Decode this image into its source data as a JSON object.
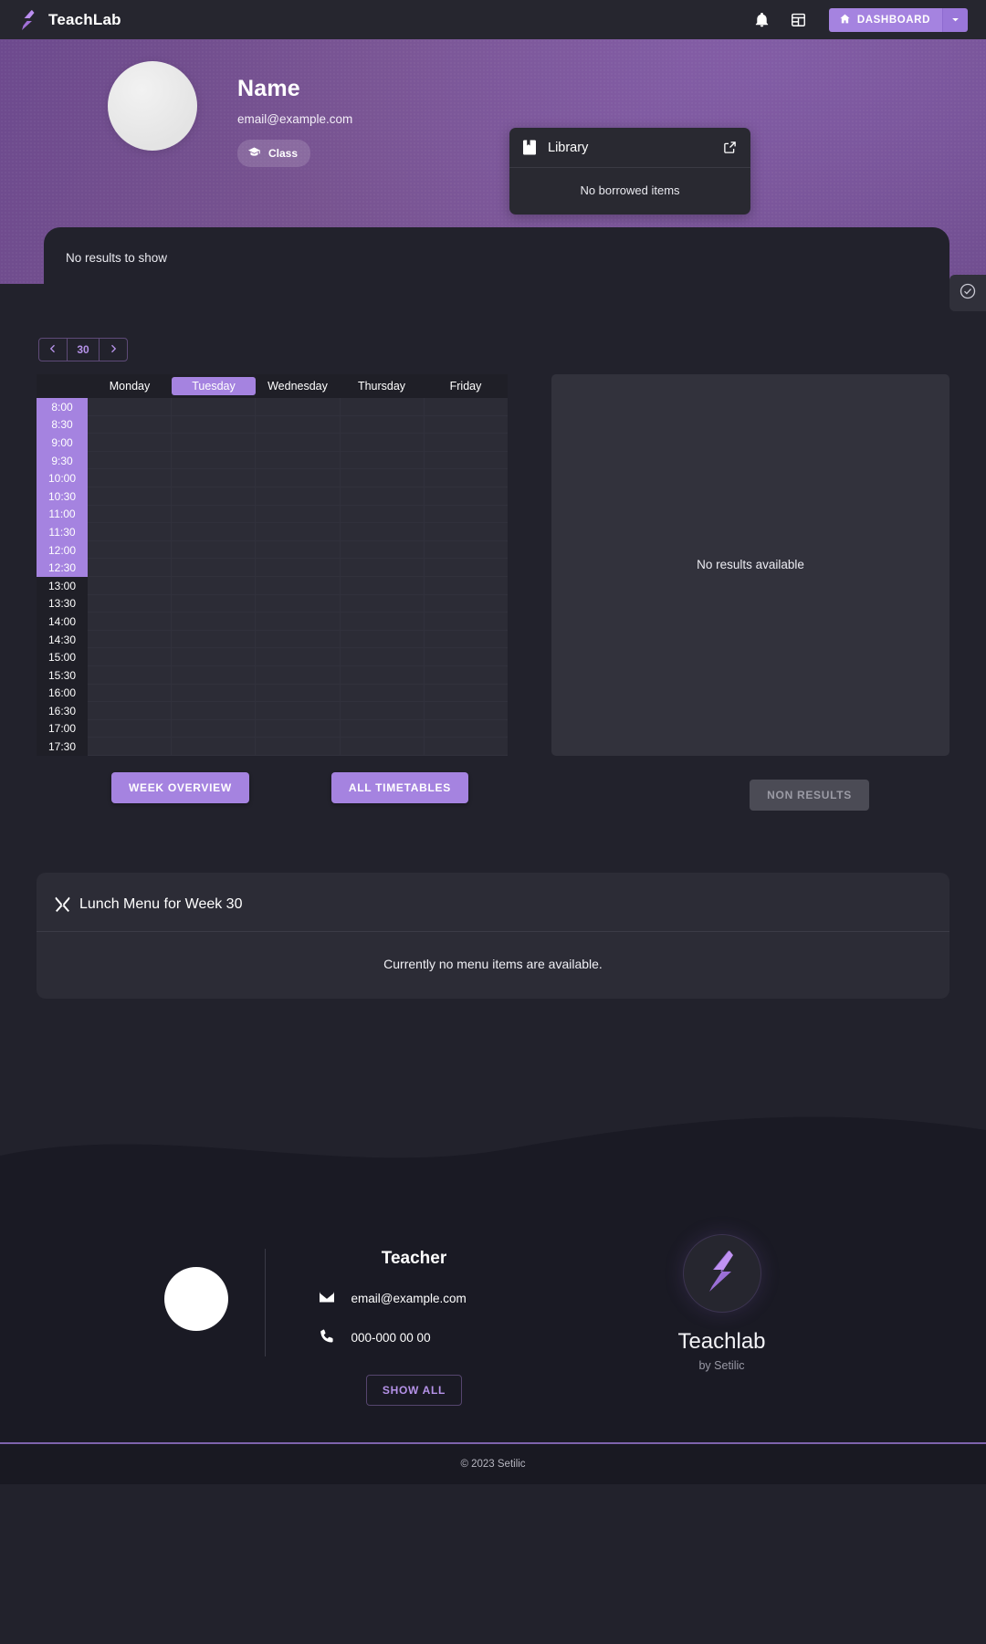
{
  "topnav": {
    "brand": "TeachLab",
    "logo_icon": "setilic-s-logo",
    "bell_icon": "bell-icon",
    "calendar_icon": "calendar-icon",
    "dashboard_label": "DASHBOARD",
    "dashboard_icon": "home-icon",
    "caret_icon": "chevron-down-icon",
    "accent": "#a583e0"
  },
  "hero": {
    "avatar": "profile-avatar",
    "name": "Name",
    "email": "email@example.com",
    "class_chip": "Class",
    "class_icon": "graduation-cap-icon",
    "bg_color": "#77538f"
  },
  "library": {
    "title": "Library",
    "icon": "book-icon",
    "external_icon": "external-link-icon",
    "empty_text": "No borrowed items"
  },
  "notice": {
    "text": "No results to show"
  },
  "check_tab": {
    "icon": "check-circle-icon"
  },
  "timetable": {
    "week_number": "30",
    "prev_icon": "chevron-left-icon",
    "next_icon": "chevron-right-icon",
    "days": [
      {
        "label": "Monday",
        "active": false
      },
      {
        "label": "Tuesday",
        "active": true
      },
      {
        "label": "Wednesday",
        "active": false
      },
      {
        "label": "Thursday",
        "active": false
      },
      {
        "label": "Friday",
        "active": false
      }
    ],
    "times": [
      {
        "label": "8:00",
        "highlighted": true
      },
      {
        "label": "8:30",
        "highlighted": true
      },
      {
        "label": "9:00",
        "highlighted": true
      },
      {
        "label": "9:30",
        "highlighted": true
      },
      {
        "label": "10:00",
        "highlighted": true
      },
      {
        "label": "10:30",
        "highlighted": true
      },
      {
        "label": "11:00",
        "highlighted": true
      },
      {
        "label": "11:30",
        "highlighted": true
      },
      {
        "label": "12:00",
        "highlighted": true
      },
      {
        "label": "12:30",
        "highlighted": true
      },
      {
        "label": "13:00",
        "highlighted": false
      },
      {
        "label": "13:30",
        "highlighted": false
      },
      {
        "label": "14:00",
        "highlighted": false
      },
      {
        "label": "14:30",
        "highlighted": false
      },
      {
        "label": "15:00",
        "highlighted": false
      },
      {
        "label": "15:30",
        "highlighted": false
      },
      {
        "label": "16:00",
        "highlighted": false
      },
      {
        "label": "16:30",
        "highlighted": false
      },
      {
        "label": "17:00",
        "highlighted": false
      },
      {
        "label": "17:30",
        "highlighted": false
      }
    ]
  },
  "side_panel": {
    "empty_text": "No results available"
  },
  "buttons": {
    "week_overview": "WEEK OVERVIEW",
    "all_timetables": "ALL TIMETABLES",
    "non_results": "NON RESULTS"
  },
  "lunch": {
    "icon": "cutlery-icon",
    "title": "Lunch Menu for Week 30",
    "empty_text": "Currently no menu items are available."
  },
  "footer": {
    "avatar": "teacher-avatar",
    "role": "Teacher",
    "email": "email@example.com",
    "email_icon": "mail-icon",
    "phone": "000-000 00 00",
    "phone_icon": "phone-icon",
    "show_all": "SHOW ALL",
    "brand_name": "Teachlab",
    "brand_sub": "by Setilic",
    "brand_icon": "setilic-s-logo"
  },
  "copyright": {
    "text": "© 2023 Setilic"
  }
}
